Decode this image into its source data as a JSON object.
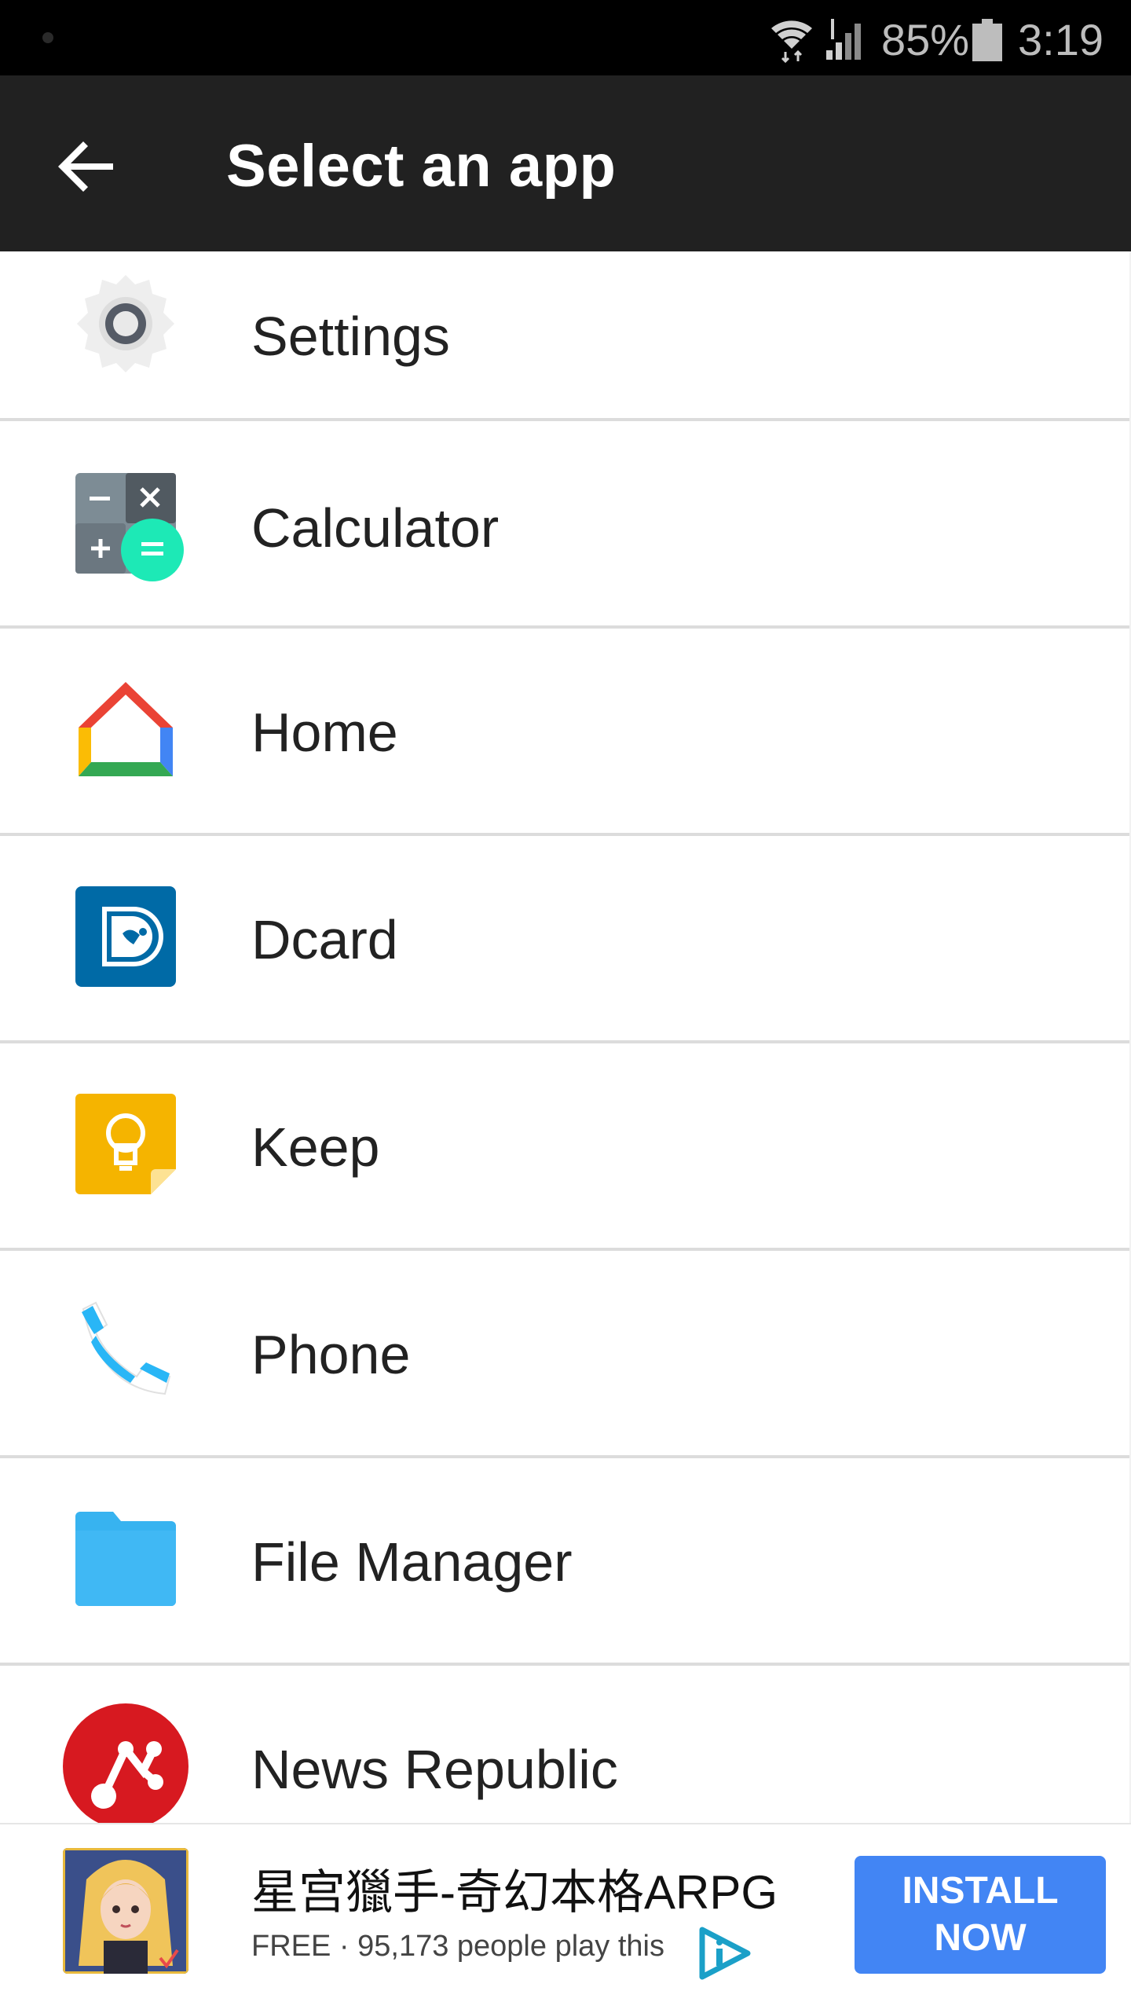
{
  "status_bar": {
    "battery": "85%",
    "time": "3:19"
  },
  "toolbar": {
    "title": "Select an app",
    "back_icon": "arrow-left-icon"
  },
  "apps": [
    {
      "label": "Settings",
      "icon": "settings-gear-icon"
    },
    {
      "label": "Calculator",
      "icon": "calculator-icon"
    },
    {
      "label": "Home",
      "icon": "google-home-icon"
    },
    {
      "label": "Dcard",
      "icon": "dcard-icon"
    },
    {
      "label": "Keep",
      "icon": "keep-lightbulb-icon"
    },
    {
      "label": "Phone",
      "icon": "phone-handset-icon"
    },
    {
      "label": "File Manager",
      "icon": "folder-icon"
    },
    {
      "label": "News Republic",
      "icon": "news-republic-icon"
    }
  ],
  "ad": {
    "title": "星宫獵手-奇幻本格ARPG",
    "subtitle": "FREE · 95,173 people play this",
    "install_label": "INSTALL NOW",
    "colors": {
      "install_button": "#4285f4"
    }
  }
}
